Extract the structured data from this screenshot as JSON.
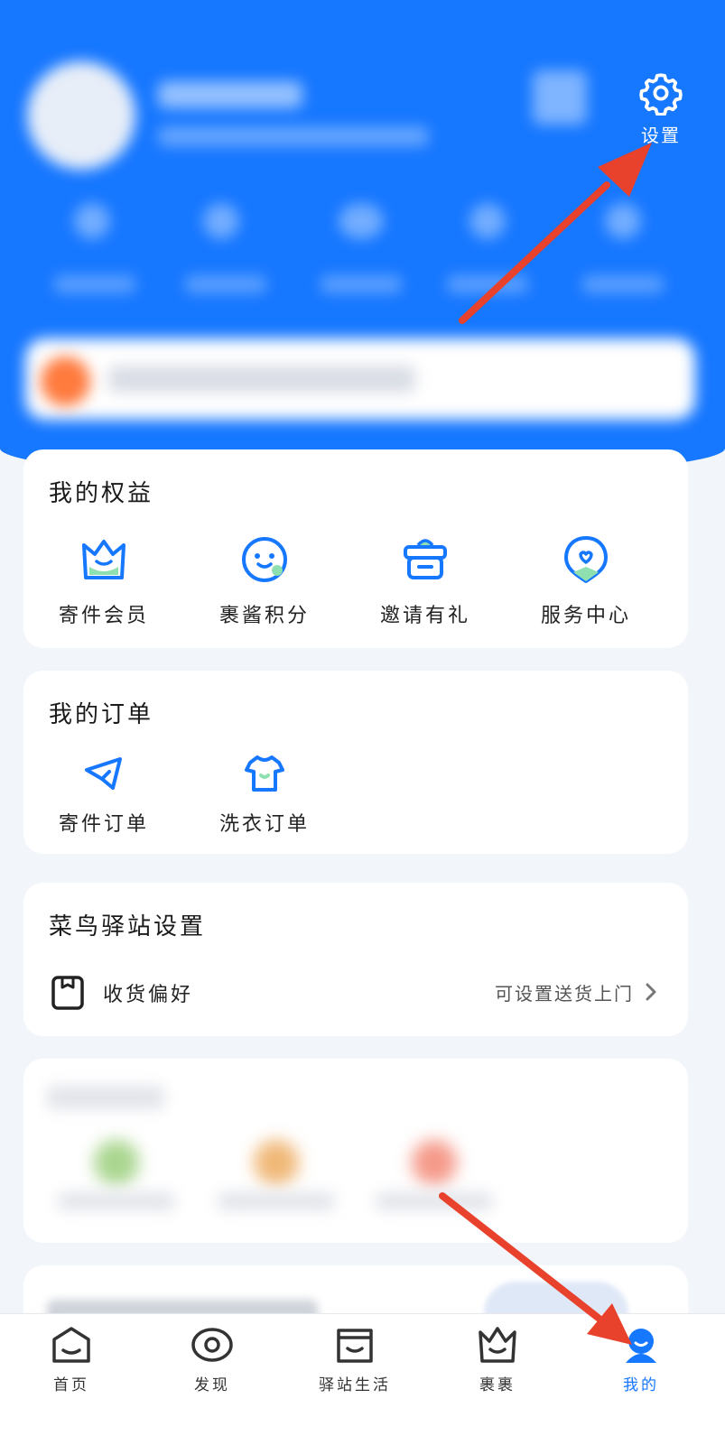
{
  "header": {
    "settings_label": "设置"
  },
  "benefits": {
    "title": "我的权益",
    "items": [
      {
        "label": "寄件会员",
        "icon": "crown-icon"
      },
      {
        "label": "裹酱积分",
        "icon": "smiley-icon"
      },
      {
        "label": "邀请有礼",
        "icon": "gift-icon"
      },
      {
        "label": "服务中心",
        "icon": "service-badge-icon"
      }
    ]
  },
  "orders": {
    "title": "我的订单",
    "items": [
      {
        "label": "寄件订单",
        "icon": "paper-plane-icon"
      },
      {
        "label": "洗衣订单",
        "icon": "tshirt-icon"
      }
    ]
  },
  "station": {
    "title": "菜鸟驿站设置",
    "row": {
      "label": "收货偏好",
      "value": "可设置送货上门"
    }
  },
  "tabbar": {
    "items": [
      {
        "label": "首页",
        "icon": "home-icon"
      },
      {
        "label": "发现",
        "icon": "eye-icon"
      },
      {
        "label": "驿站生活",
        "icon": "station-icon"
      },
      {
        "label": "裹裹",
        "icon": "crown-icon"
      },
      {
        "label": "我的",
        "icon": "profile-icon"
      }
    ],
    "active": "我的"
  },
  "colors": {
    "brand_blue": "#1677ff",
    "annotation_red": "#e8412c"
  }
}
